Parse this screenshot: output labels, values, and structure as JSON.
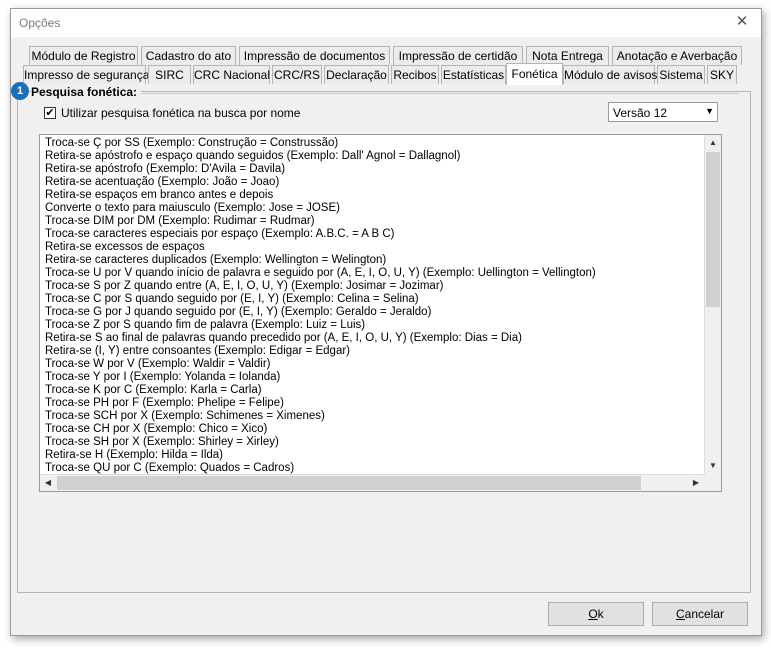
{
  "window": {
    "title": "Opções",
    "close_icon": "close-icon"
  },
  "tabs_row1": [
    {
      "label": "Módulo de Registro"
    },
    {
      "label": "Cadastro do ato"
    },
    {
      "label": "Impressão de documentos"
    },
    {
      "label": "Impressão de certidão"
    },
    {
      "label": "Nota Entrega"
    },
    {
      "label": "Anotação e Averbação"
    }
  ],
  "tabs_row2": [
    {
      "label": "Impresso de segurança"
    },
    {
      "label": "SIRC"
    },
    {
      "label": "CRC Nacional"
    },
    {
      "label": "CRC/RS"
    },
    {
      "label": "Declaração"
    },
    {
      "label": "Recibos"
    },
    {
      "label": "Estatísticas"
    },
    {
      "label": "Fonética",
      "active": true
    },
    {
      "label": "Módulo de avisos"
    },
    {
      "label": "Sistema"
    },
    {
      "label": "SKY"
    }
  ],
  "section": {
    "badge": "1",
    "title": "Pesquisa fonética:"
  },
  "phonetic": {
    "checkbox_label": "Utilizar pesquisa fonética na busca por nome",
    "checked": true,
    "check_mark": "✔",
    "version": "Versão 12"
  },
  "rules": [
    "Troca-se Ç por SS (Exemplo: Construção = Construssão)",
    "Retira-se apóstrofo e espaço quando seguidos (Exemplo: Dall' Agnol = Dallagnol)",
    "Retira-se apóstrofo (Exemplo: D'Avila = Davila)",
    "Retira-se acentuação (Exemplo: João = Joao)",
    "Retira-se espaços em branco antes e depois",
    "Converte o texto para maiusculo (Exemplo: Jose = JOSE)",
    "Troca-se DIM por DM (Exemplo: Rudimar = Rudmar)",
    "Troca-se caracteres especiais por espaço (Exemplo: A.B.C. = A B C)",
    "Retira-se excessos de espaços",
    "Retira-se caracteres duplicados (Exemplo: Wellington = Welington)",
    "Troca-se U por V quando início de palavra e seguido por (A, E, I, O, U, Y) (Exemplo: Uellington = Vellington)",
    "Troca-se S por Z quando entre (A, E, I, O, U, Y) (Exemplo: Josimar = Jozimar)",
    "Troca-se C por S quando seguido por (E, I, Y) (Exemplo: Celina = Selina)",
    "Troca-se G por J quando seguido por (E, I, Y) (Exemplo: Geraldo = Jeraldo)",
    "Troca-se Z por S quando fim de palavra (Exemplo: Luiz = Luis)",
    "Retira-se S ao final de palavras quando precedido por (A, E, I, O, U, Y) (Exemplo: Dias = Dia)",
    "Retira-se (I, Y) entre consoantes (Exemplo: Edigar = Edgar)",
    "Troca-se W por V (Exemplo: Waldir = Valdir)",
    "Troca-se Y por I (Exemplo: Yolanda = Iolanda)",
    "Troca-se K por C (Exemplo: Karla = Carla)",
    "Troca-se PH por F (Exemplo: Phelipe = Felipe)",
    "Troca-se SCH por X (Exemplo: Schimenes = Ximenes)",
    "Troca-se CH por X (Exemplo: Chico = Xico)",
    "Troca-se SH por X (Exemplo: Shirley = Xirley)",
    "Retira-se H (Exemplo: Hilda = Ilda)",
    "Troca-se QU por C (Exemplo: Quados = Cadros)"
  ],
  "scroll": {
    "up": "▲",
    "down": "▼",
    "left": "◀",
    "right": "▶"
  },
  "buttons": {
    "ok": {
      "mnemonic": "O",
      "rest": "k"
    },
    "cancel": {
      "mnemonic": "C",
      "rest": "ancelar"
    }
  }
}
